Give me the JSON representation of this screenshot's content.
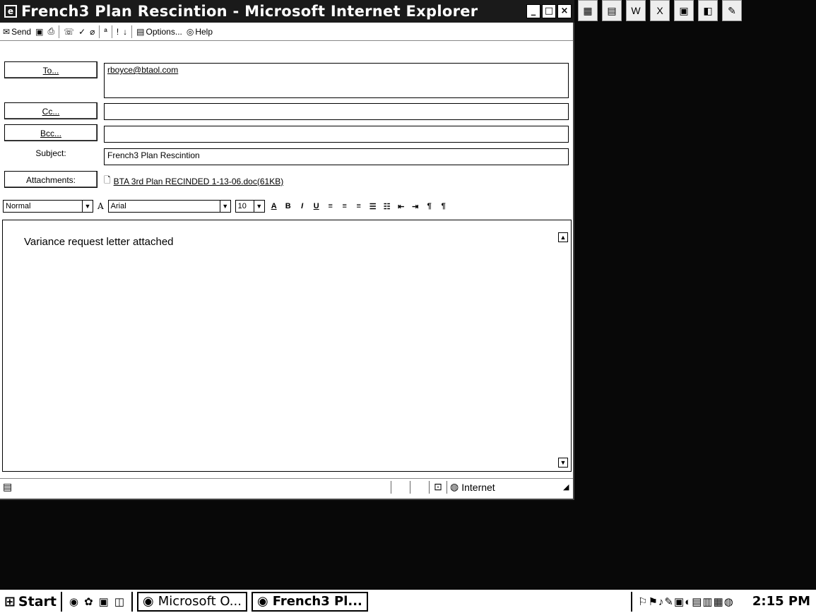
{
  "window": {
    "title": "French3 Plan Rescintion - Microsoft Internet Explorer",
    "controls": [
      "_",
      "□",
      "×"
    ]
  },
  "toolbar": {
    "send_label": "Send",
    "options_label": "Options...",
    "help_label": "Help"
  },
  "fields": {
    "to_label": "To...",
    "to_value": "rboyce@btaol.com",
    "cc_label": "Cc...",
    "cc_value": "",
    "bcc_label": "Bcc...",
    "bcc_value": "",
    "subject_label": "Subject:",
    "subject_value": "French3 Plan Rescintion",
    "attachments_label": "Attachments:",
    "attachment_name": "BTA 3rd Plan RECINDED 1-13-06.doc(61KB)"
  },
  "format": {
    "style": "Normal",
    "font": "Arial",
    "size": "10",
    "buttons": [
      "A",
      "B",
      "I",
      "U"
    ]
  },
  "editor": {
    "body_text": "Variance request letter attached"
  },
  "status": {
    "zone": "Internet"
  },
  "taskbar": {
    "start_label": "Start",
    "tasks": [
      {
        "label": "Microsoft O..."
      },
      {
        "label": "French3 Pl..."
      }
    ],
    "clock": "2:15 PM"
  }
}
